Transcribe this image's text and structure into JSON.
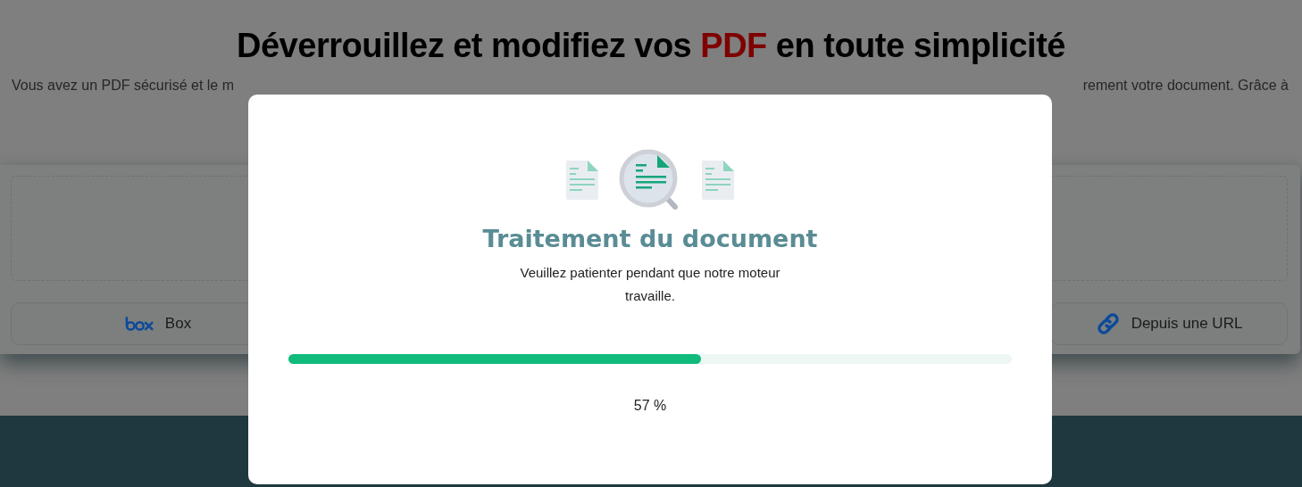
{
  "page": {
    "title": [
      {
        "text": "Déverrouillez et modifiez vos ",
        "kind": "plain"
      },
      {
        "text": "PDF",
        "kind": "accent"
      },
      {
        "text": " en toute simplicité",
        "kind": "plain"
      }
    ],
    "intro_visible_parts": [
      "Vous avez un PDF sécurisé et le m",
      "rement votre document. Grâce à"
    ],
    "sources": [
      {
        "label": "Box",
        "kind": "box"
      },
      {
        "label": "Depuis une URL",
        "kind": "link"
      }
    ]
  },
  "dialog": {
    "title": "Traitement du document",
    "message": "Veuillez patienter pendant que notre moteur travaille.",
    "progress": {
      "level": 0.57
    },
    "percent": "57 %"
  }
}
